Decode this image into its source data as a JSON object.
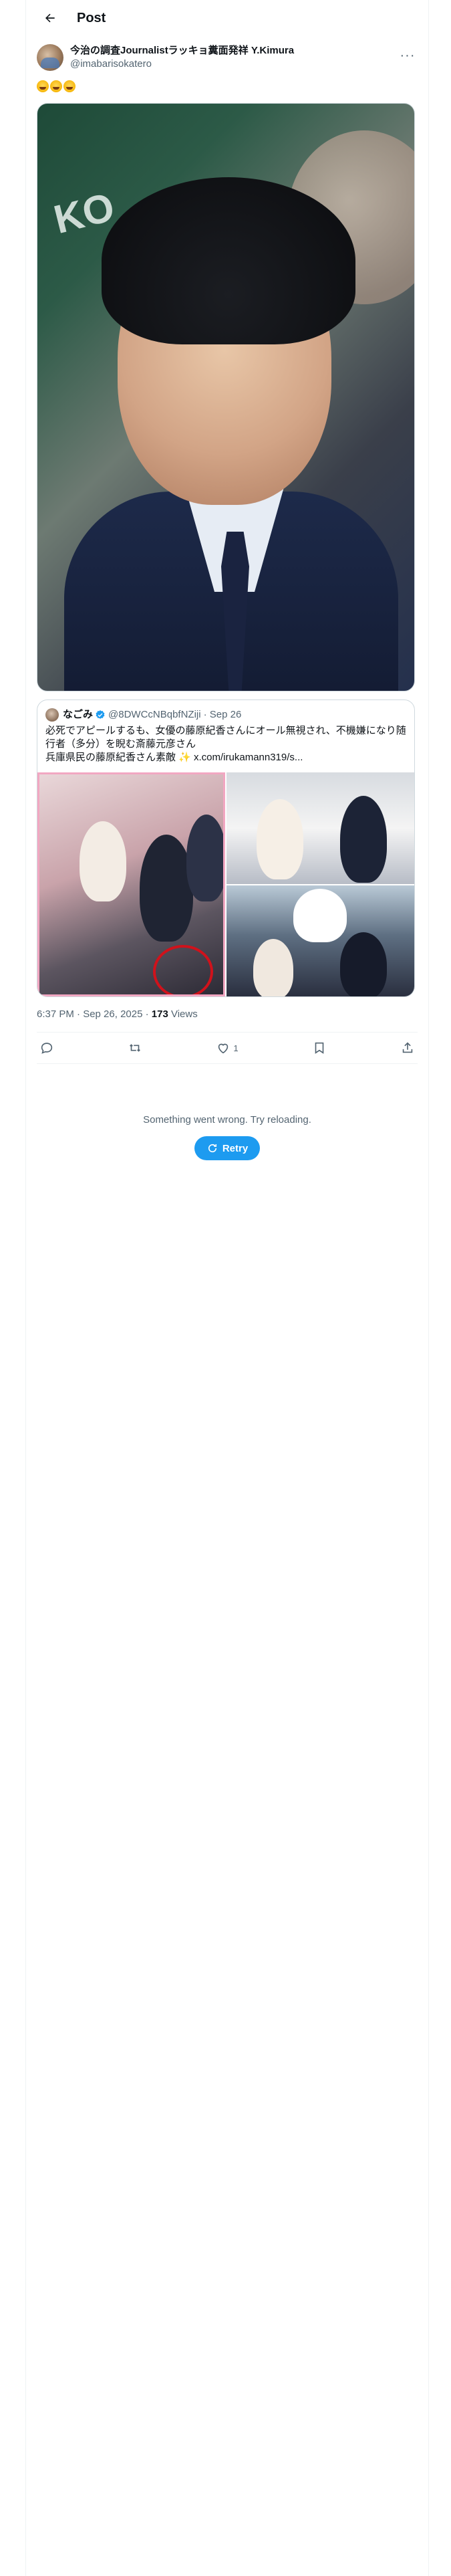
{
  "header": {
    "title": "Post"
  },
  "post": {
    "author": {
      "display_name": "今治の調査Journalistラッキョ糞面発祥 Y.Kimura",
      "handle": "@imabarisokatero"
    },
    "text": "🤣🤣🤣",
    "timestamp": "6:37 PM · Sep 26, 2025",
    "views_count": "173",
    "views_label": "Views",
    "likes_count": "1"
  },
  "quote": {
    "display_name": "なごみ",
    "handle": "@8DWCcNBqbfNZiji",
    "date": "· Sep 26",
    "text": "必死でアピールするも、女優の藤原紀香さんにオール無視され、不機嫌になり随行者（多分）を睨む斎藤元彦さん\n兵庫県民の藤原紀香さん素敵 ✨ x.com/irukamann319/s..."
  },
  "error": {
    "message": "Something went wrong. Try reloading.",
    "retry_label": "Retry"
  },
  "colors": {
    "accent": "#1d9bf0",
    "text": "#0f1419",
    "muted": "#536471",
    "border": "#cfd9de"
  }
}
